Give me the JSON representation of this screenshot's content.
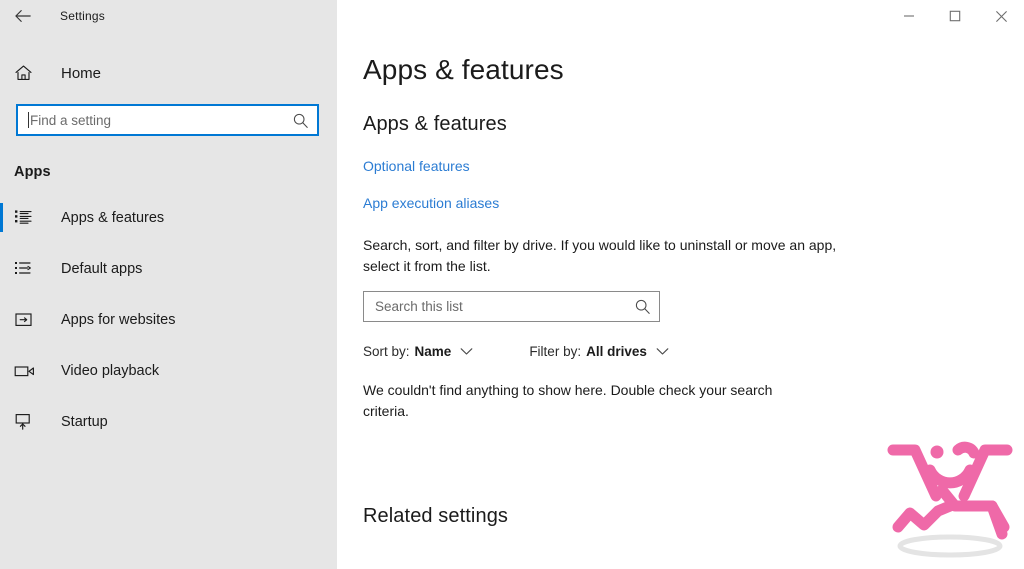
{
  "titlebar": {
    "back_icon": "back-arrow-icon",
    "title": "Settings",
    "minimize_icon": "minimize-icon",
    "maximize_icon": "maximize-icon",
    "close_icon": "close-icon"
  },
  "sidebar": {
    "home": {
      "label": "Home",
      "icon": "home-icon"
    },
    "search": {
      "placeholder": "Find a setting",
      "value": "",
      "icon": "search-icon"
    },
    "section_label": "Apps",
    "items": [
      {
        "label": "Apps & features",
        "icon": "list-bullets-icon",
        "selected": true
      },
      {
        "label": "Default apps",
        "icon": "default-apps-icon",
        "selected": false
      },
      {
        "label": "Apps for websites",
        "icon": "app-window-arrow-icon",
        "selected": false
      },
      {
        "label": "Video playback",
        "icon": "video-camera-icon",
        "selected": false
      },
      {
        "label": "Startup",
        "icon": "startup-monitor-icon",
        "selected": false
      }
    ]
  },
  "main": {
    "page_title": "Apps & features",
    "sub_title": "Apps & features",
    "links": [
      {
        "label": "Optional features"
      },
      {
        "label": "App execution aliases"
      }
    ],
    "description": "Search, sort, and filter by drive. If you would like to uninstall or move an app, select it from the list.",
    "list_search": {
      "placeholder": "Search this list",
      "value": "",
      "icon": "search-icon"
    },
    "filters": [
      {
        "label": "Sort by:",
        "value": "Name",
        "icon": "chevron-down-icon"
      },
      {
        "label": "Filter by:",
        "value": "All drives",
        "icon": "chevron-down-icon"
      }
    ],
    "empty_message": "We couldn't find anything to show here. Double check your search criteria.",
    "related_settings_title": "Related settings"
  },
  "watermark": {
    "name": "pink-happy-figure-watermark",
    "color": "#ef69a8",
    "shadow_color": "#e2e2e2"
  },
  "colors": {
    "sidebar_bg": "#e6e6e6",
    "main_bg": "#ffffff",
    "accent": "#0078d4",
    "link": "#2b7cd3",
    "text": "#1b1b1b",
    "muted_text": "#6b6b6b",
    "input_border": "#8a8a8a"
  }
}
